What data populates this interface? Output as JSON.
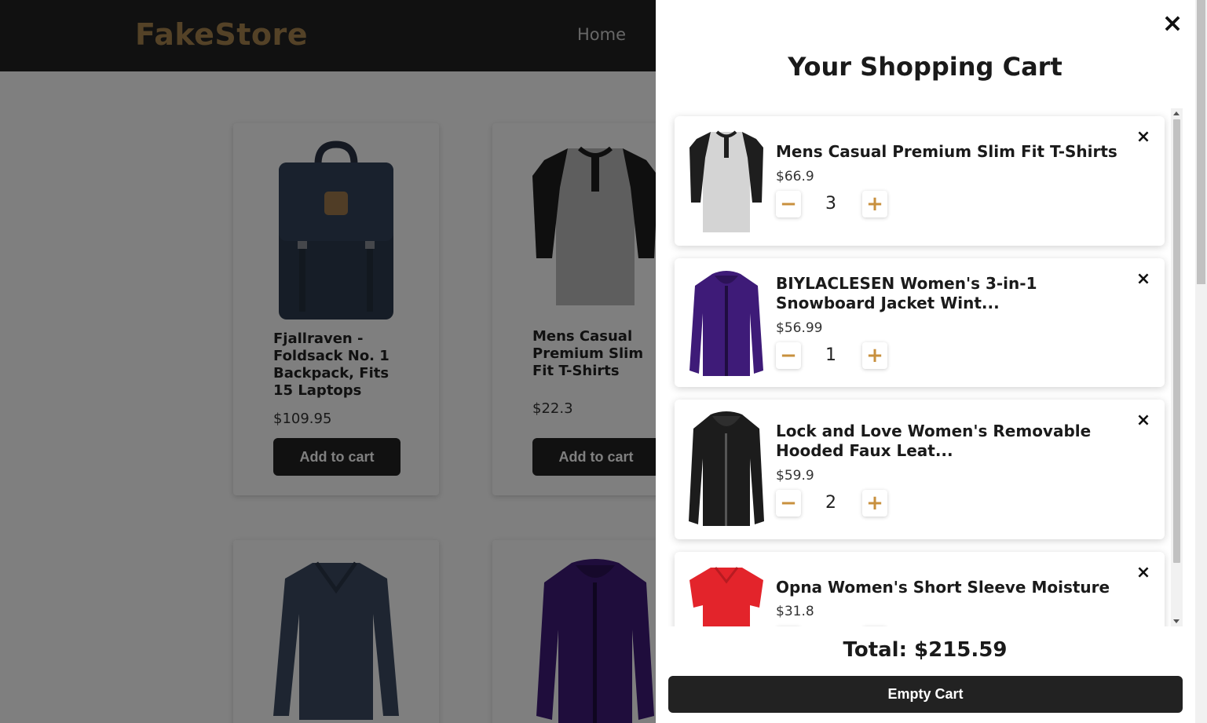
{
  "header": {
    "logo": "FakeStore",
    "nav_home": "Home"
  },
  "products": [
    {
      "title": "Fjallraven - Foldsack No. 1 Backpack, Fits 15 Laptops",
      "price": "$109.95",
      "button": "Add to cart",
      "icon": "backpack-image"
    },
    {
      "title": "Mens Casual Premium Slim Fit T-Shirts",
      "price": "$22.3",
      "button": "Add to cart",
      "icon": "raglan-tshirt-image"
    },
    {
      "title": "",
      "price": "",
      "button": "",
      "icon": "longsleeve-shirt-image"
    },
    {
      "title": "",
      "price": "",
      "button": "",
      "icon": "purple-jacket-image"
    }
  ],
  "cart": {
    "close_icon": "×",
    "title": "Your Shopping Cart",
    "items": [
      {
        "name": "Mens Casual Premium Slim Fit T-Shirts",
        "price": "$66.9",
        "qty": "3",
        "minus": "−",
        "plus": "+",
        "remove": "×"
      },
      {
        "name": "BIYLACLESEN Women's 3-in-1 Snowboard Jacket Wint...",
        "price": "$56.99",
        "qty": "1",
        "minus": "−",
        "plus": "+",
        "remove": "×"
      },
      {
        "name": "Lock and Love Women's Removable Hooded Faux Leat...",
        "price": "$59.9",
        "qty": "2",
        "minus": "−",
        "plus": "+",
        "remove": "×"
      },
      {
        "name": "Opna Women's Short Sleeve Moisture",
        "price": "$31.8",
        "qty": "",
        "minus": "−",
        "plus": "+",
        "remove": "×"
      }
    ],
    "total": "Total: $215.59",
    "empty_button": "Empty Cart"
  },
  "colors": {
    "brand": "#a8844f",
    "header_bg": "#222222",
    "accent_qty": "#c8903e",
    "overlay": "rgba(0,0,0,0.5)"
  }
}
